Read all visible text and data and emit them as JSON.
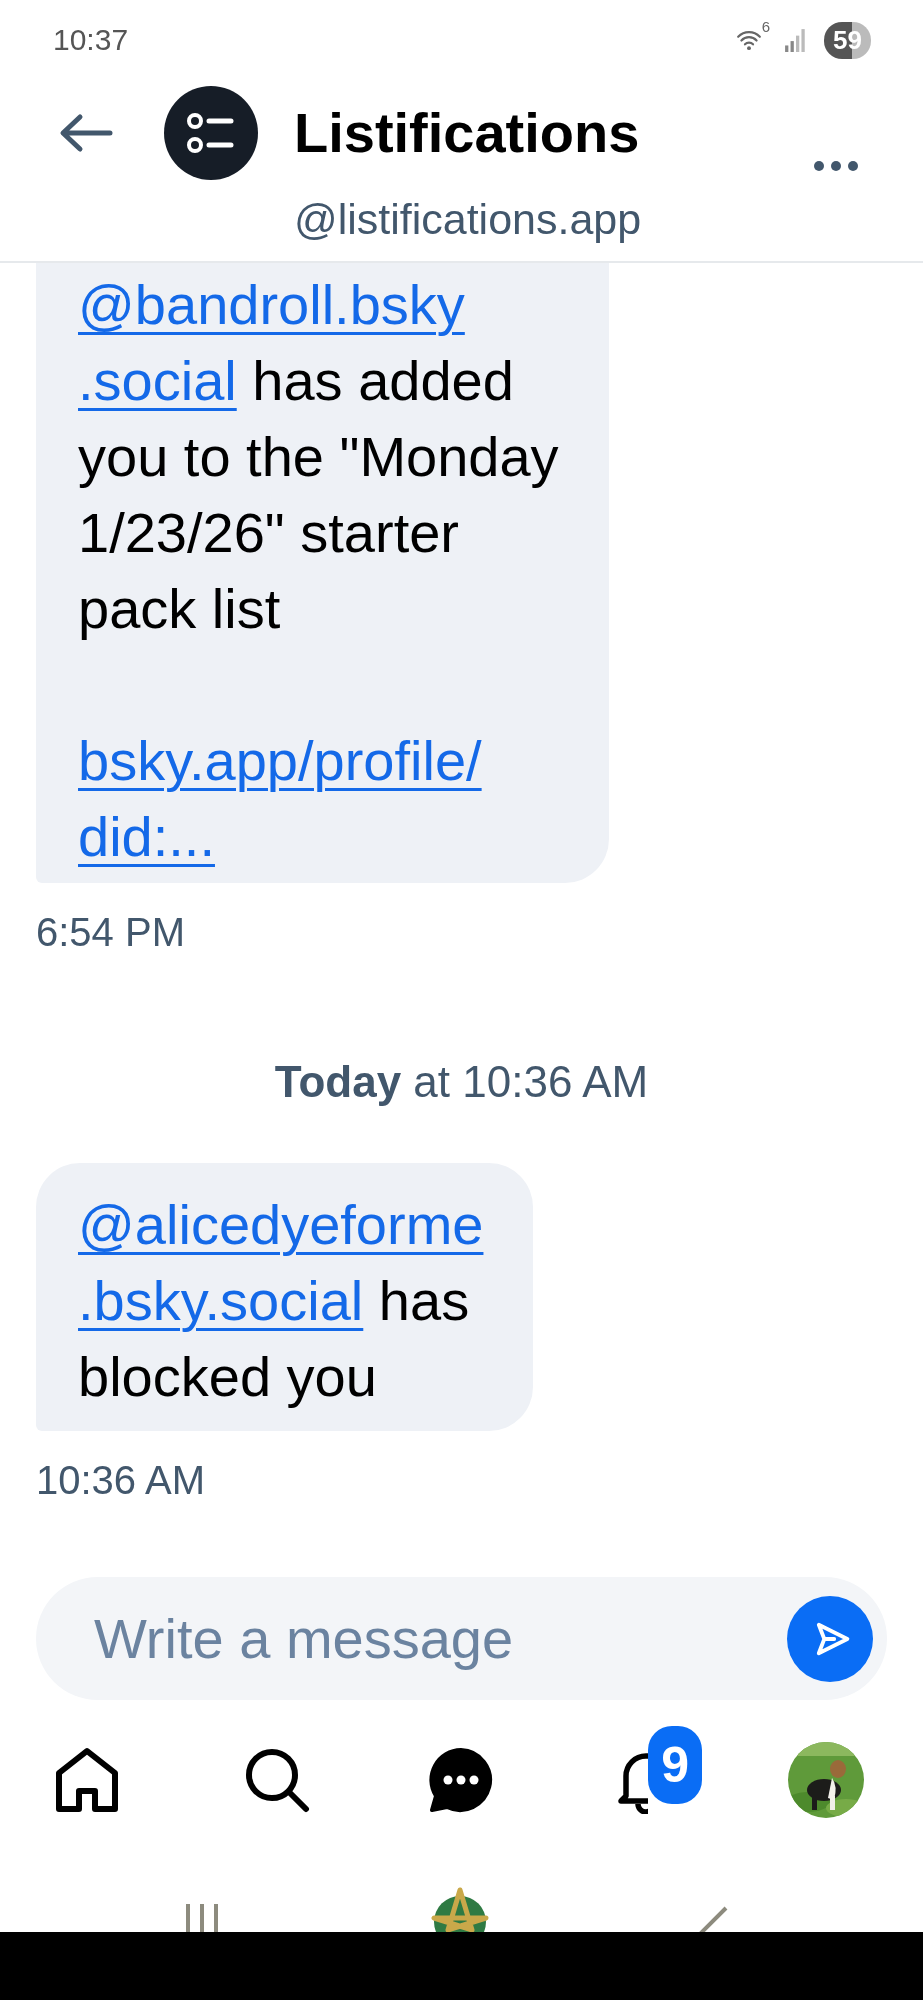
{
  "status_bar": {
    "time": "10:37",
    "wifi_badge": "6",
    "battery": "59"
  },
  "header": {
    "title": "Listifications",
    "handle": "@listifications.app"
  },
  "conversation": [
    {
      "kind": "message",
      "paragraphs": [
        [
          [
            {
              "text": "@bandroll.bsky",
              "link": true
            }
          ],
          [
            {
              "text": ".social",
              "link": true
            },
            {
              "text": " has added",
              "link": false
            }
          ],
          [
            {
              "text": "you to the \"Monday",
              "link": false
            }
          ],
          [
            {
              "text": "1/23/26\" starter",
              "link": false
            }
          ],
          [
            {
              "text": "pack list",
              "link": false
            }
          ]
        ],
        [
          [
            {
              "text": "bsky.app/profile/",
              "link": true
            }
          ],
          [
            {
              "text": "did:...",
              "link": true
            }
          ]
        ]
      ]
    },
    {
      "kind": "time",
      "text": "6:54 PM"
    },
    {
      "kind": "date",
      "text": "**Today** at 10:36 AM"
    },
    {
      "kind": "message",
      "paragraphs": [
        [
          [
            {
              "text": "@alicedyeforme",
              "link": true
            }
          ],
          [
            {
              "text": ".bsky.social",
              "link": true
            },
            {
              "text": " has",
              "link": false
            }
          ],
          [
            {
              "text": "blocked you",
              "link": false
            }
          ]
        ]
      ]
    },
    {
      "kind": "time",
      "text": "10:36 AM"
    }
  ],
  "composer": {
    "placeholder": "Write a message"
  },
  "nav": [
    {
      "kind": "home",
      "selected": false
    },
    {
      "kind": "search",
      "selected": false
    },
    {
      "kind": "chat",
      "selected": true
    },
    {
      "kind": "notifications",
      "selected": false,
      "badge": "9"
    },
    {
      "kind": "profile",
      "selected": false
    }
  ]
}
